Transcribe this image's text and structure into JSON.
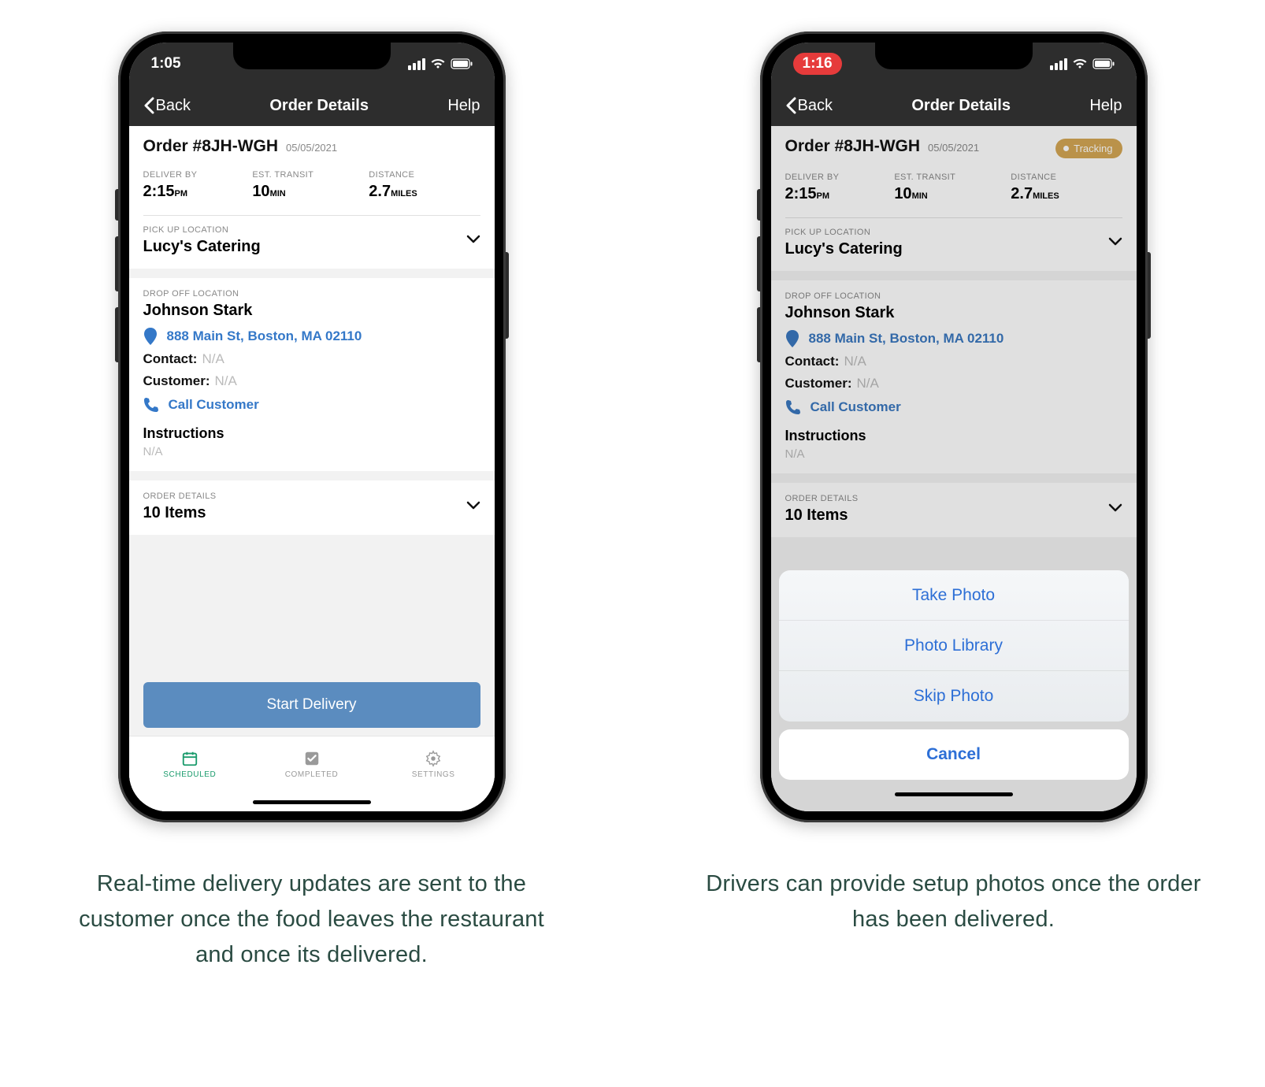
{
  "captions": {
    "left": "Real-time delivery updates are sent to the customer  once the food leaves the restaurant  and once its delivered.",
    "right": "Drivers can provide setup photos once the order has been delivered."
  },
  "phone1": {
    "status_time": "1:05",
    "nav": {
      "back": "Back",
      "title": "Order Details",
      "help": "Help"
    },
    "order": {
      "id": "Order #8JH-WGH",
      "date": "05/05/2021"
    },
    "metrics": {
      "deliver_by_label": "DELIVER BY",
      "deliver_by_value": "2:15",
      "deliver_by_suffix": "PM",
      "transit_label": "EST. TRANSIT",
      "transit_value": "10",
      "transit_suffix": "MIN",
      "distance_label": "DISTANCE",
      "distance_value": "2.7",
      "distance_suffix": "MILES"
    },
    "pickup": {
      "label": "PICK UP LOCATION",
      "name": "Lucy's Catering"
    },
    "dropoff": {
      "label": "DROP OFF LOCATION",
      "name": "Johnson Stark",
      "address": "888 Main St, Boston, MA 02110",
      "contact_label": "Contact:",
      "contact_value": "N/A",
      "customer_label": "Customer:",
      "customer_value": "N/A",
      "call": "Call Customer",
      "instructions_label": "Instructions",
      "instructions_value": "N/A"
    },
    "order_details": {
      "label": "ORDER DETAILS",
      "value": "10 Items"
    },
    "start_button": "Start Delivery",
    "tabs": {
      "scheduled": "SCHEDULED",
      "completed": "COMPLETED",
      "settings": "SETTINGS"
    }
  },
  "phone2": {
    "status_time": "1:16",
    "nav": {
      "back": "Back",
      "title": "Order Details",
      "help": "Help"
    },
    "order": {
      "id": "Order #8JH-WGH",
      "date": "05/05/2021"
    },
    "tracking_badge": "Tracking",
    "metrics": {
      "deliver_by_label": "DELIVER BY",
      "deliver_by_value": "2:15",
      "deliver_by_suffix": "PM",
      "transit_label": "EST. TRANSIT",
      "transit_value": "10",
      "transit_suffix": "MIN",
      "distance_label": "DISTANCE",
      "distance_value": "2.7",
      "distance_suffix": "MILES"
    },
    "pickup": {
      "label": "PICK UP LOCATION",
      "name": "Lucy's Catering"
    },
    "dropoff": {
      "label": "DROP OFF LOCATION",
      "name": "Johnson Stark",
      "address": "888 Main St, Boston, MA 02110",
      "contact_label": "Contact:",
      "contact_value": "N/A",
      "customer_label": "Customer:",
      "customer_value": "N/A",
      "call": "Call Customer",
      "instructions_label": "Instructions",
      "instructions_value": "N/A"
    },
    "order_details": {
      "label": "ORDER DETAILS",
      "value": "10 Items"
    },
    "sheet": {
      "take_photo": "Take Photo",
      "photo_library": "Photo Library",
      "skip_photo": "Skip Photo",
      "cancel": "Cancel"
    }
  }
}
